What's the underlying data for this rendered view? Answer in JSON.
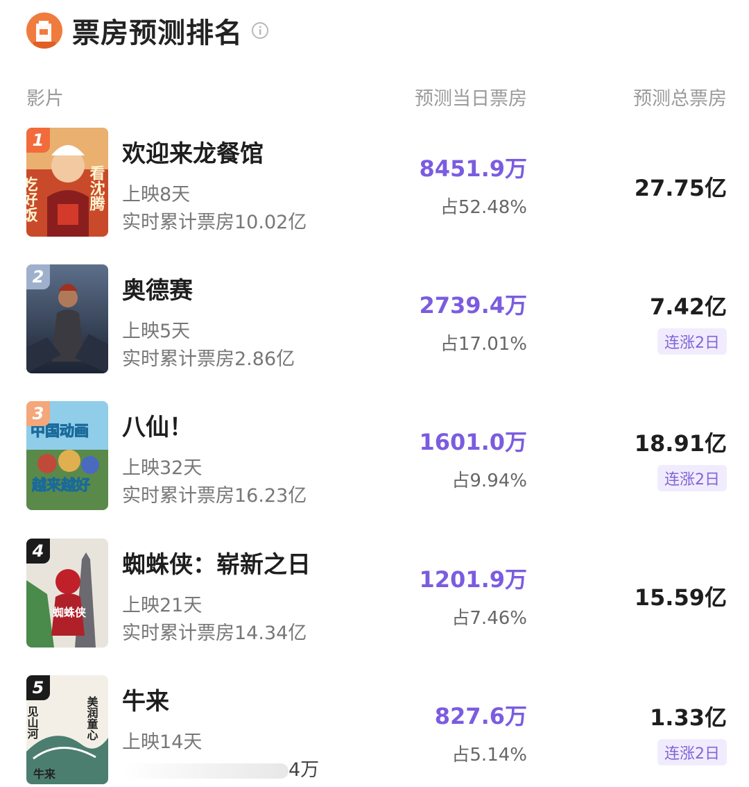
{
  "header": {
    "title": "票房预测排名",
    "logo_icon": "ticket-booth-icon",
    "info_icon": "info-circle-icon"
  },
  "columns": {
    "film": "影片",
    "daily": "预测当日票房",
    "total": "预测总票房"
  },
  "colors": {
    "accent": "#7b5ce0",
    "badge_bg": "#f1ecfd",
    "rank1": "#f26b3a",
    "rank2": "#9fb0cc",
    "rank3": "#f4a77a",
    "rank_other": "#1b1b1b"
  },
  "movies": [
    {
      "rank": "1",
      "name": "欢迎来龙餐馆",
      "days": "上映8天",
      "cumulative": "实时累计票房10.02亿",
      "daily": "8451.9万",
      "share": "占52.48%",
      "total": "27.75亿",
      "badge": "",
      "poster_text_left": "吃好饭",
      "poster_text_right": "看沈腾"
    },
    {
      "rank": "2",
      "name": "奥德赛",
      "days": "上映5天",
      "cumulative": "实时累计票房2.86亿",
      "daily": "2739.4万",
      "share": "占17.01%",
      "total": "7.42亿",
      "badge": "连涨2日"
    },
    {
      "rank": "3",
      "name": "八仙！",
      "days": "上映32天",
      "cumulative": "实时累计票房16.23亿",
      "daily": "1601.0万",
      "share": "占9.94%",
      "total": "18.91亿",
      "badge": "连涨2日",
      "poster_text_top": "中国动画",
      "poster_text_bottom": "越来越好"
    },
    {
      "rank": "4",
      "name": "蜘蛛侠：崭新之日",
      "days": "上映21天",
      "cumulative": "实时累计票房14.34亿",
      "daily": "1201.9万",
      "share": "占7.46%",
      "total": "15.59亿",
      "badge": "",
      "poster_text": "蜘蛛侠"
    },
    {
      "rank": "5",
      "name": "牛来",
      "days": "上映14天",
      "cumulative": "4万",
      "daily": "827.6万",
      "share": "占5.14%",
      "total": "1.33亿",
      "badge": "连涨2日",
      "poster_text_left": "见山河",
      "poster_text_right": "美润童心",
      "poster_text_bottom": "牛来"
    }
  ]
}
